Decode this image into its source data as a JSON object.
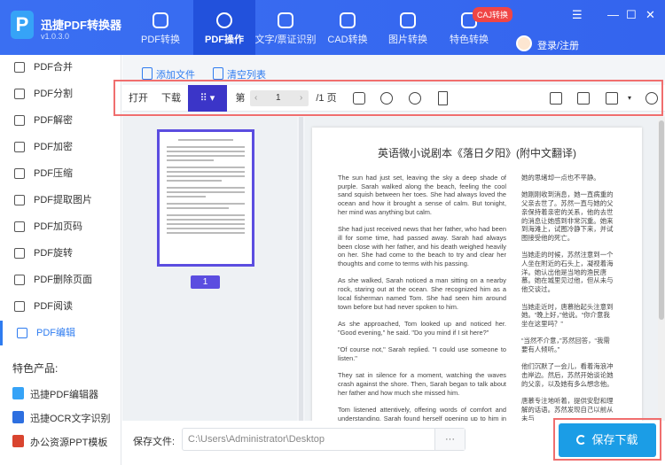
{
  "app": {
    "name": "迅捷PDF转换器",
    "version": "v1.0.3.0"
  },
  "nav": [
    {
      "label": "PDF转换"
    },
    {
      "label": "PDF操作",
      "active": true
    },
    {
      "label": "文字/票证识别"
    },
    {
      "label": "CAD转换"
    },
    {
      "label": "图片转换"
    },
    {
      "label": "特色转换"
    }
  ],
  "caj_badge": "CAJ转换",
  "login": "登录/注册",
  "window": {
    "menu": "☰",
    "minimize": "—",
    "maximize": "☐",
    "close": "✕"
  },
  "sidebar": {
    "items": [
      {
        "label": "PDF合并"
      },
      {
        "label": "PDF分割"
      },
      {
        "label": "PDF解密"
      },
      {
        "label": "PDF加密"
      },
      {
        "label": "PDF压缩"
      },
      {
        "label": "PDF提取图片"
      },
      {
        "label": "PDF加页码"
      },
      {
        "label": "PDF旋转"
      },
      {
        "label": "PDF删除页面"
      },
      {
        "label": "PDF阅读"
      },
      {
        "label": "PDF编辑",
        "active": true
      }
    ],
    "featured_title": "特色产品:",
    "products": [
      {
        "label": "迅捷PDF编辑器"
      },
      {
        "label": "迅捷OCR文字识别"
      },
      {
        "label": "办公资源PPT模板"
      }
    ]
  },
  "actions": {
    "add_file": "添加文件",
    "clear_list": "清空列表"
  },
  "toolbar": {
    "open": "打开",
    "download": "下载",
    "page_prefix": "第",
    "page": "1",
    "page_total": "/1 页",
    "prev": "‹",
    "next": "›"
  },
  "thumbnail": {
    "page_label": "1"
  },
  "document": {
    "title": "英语微小说剧本《落日夕阳》(附中文翻译)",
    "en": [
      "The sun had just set, leaving the sky a deep shade of purple. Sarah walked along the beach, feeling the cool sand squish between her toes. She had always loved the ocean and how it brought a sense of calm. But tonight, her mind was anything but calm.",
      "She had just received news that her father, who had been ill for some time, had passed away. Sarah had always been close with her father, and his death weighed heavily on her. She had come to the beach to try and clear her thoughts and come to terms with his passing.",
      "As she walked, Sarah noticed a man sitting on a nearby rock, staring out at the ocean. She recognized him as a local fisherman named Tom. She had seen him around town before but had never spoken to him.",
      "As she approached, Tom looked up and noticed her. \"Good evening,\" he said. \"Do you mind if I sit here?\"",
      "\"Of course not,\" Sarah replied. \"I could use someone to listen.\"",
      "They sat in silence for a moment, watching the waves crash against the shore. Then, Sarah began to talk about her father and how much she missed him.",
      "Tom listened attentively, offering words of comfort and understanding. Sarah found herself opening up to him in a way she never had with anyone else."
    ],
    "zh": [
      "她的思绪却一点也不平静。",
      "她刚刚收到消息，她一直病重的父亲去世了。苏然一直与她的父亲保持着亲密的关系，他的去世的消息让她感到非常沉重。她来到海滩上，试图冷静下来，并试图接受他的死亡。",
      "当她走的时候，苏然注意到一个人坐在附近的石头上，凝视着海洋。她认出他是当地的渔民唐慕。她在城里见过他，但从未与他交谈过。",
      "当她走近时，唐慕抬起头注意到她。“晚上好，”他说。“你介意我坐在这里吗？”",
      "“当然不介意，”苏然回答，“我需要有人倾听。”",
      "他们沉默了一会儿，看着海浪冲击岸边。然后，苏然开始谈论她的父亲，以及她有多么想念他。",
      "唐慕专注地听着，提供安慰和理解的话语。苏然发现自己以前从未与"
    ]
  },
  "bottom": {
    "save_label": "保存文件:",
    "path": "C:\\Users\\Administrator\\Desktop",
    "browse": "···",
    "save_button": "保存下载"
  },
  "colors": {
    "header": "#3a6ff2",
    "active_tab": "#2251dc",
    "accent": "#5b4de0",
    "save": "#1b9de6",
    "highlight": "#f06e6e"
  }
}
